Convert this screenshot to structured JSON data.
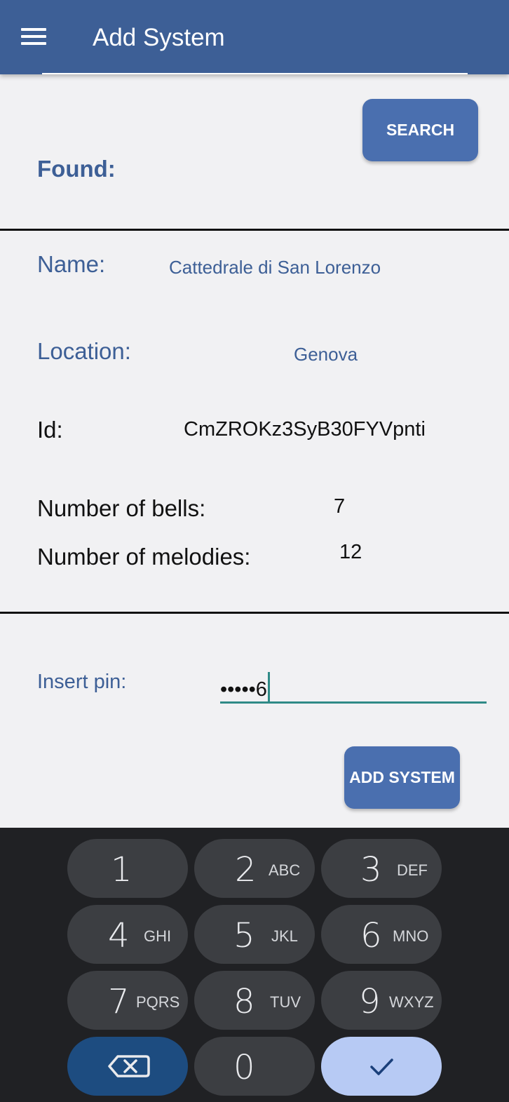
{
  "appbar": {
    "title": "Add System",
    "menu_icon": "hamburger-menu-icon"
  },
  "search": {
    "button_label": "SEARCH",
    "found_label": "Found:"
  },
  "details": {
    "name_label": "Name:",
    "name_value": "Cattedrale di San Lorenzo",
    "location_label": "Location:",
    "location_value": "Genova",
    "id_label": "Id:",
    "id_value": "CmZROKz3SyB30FYVpnti",
    "bells_label": "Number of bells:",
    "bells_value": "7",
    "melodies_label": "Number of melodies:",
    "melodies_value": "12"
  },
  "pin": {
    "label": "Insert pin:",
    "value": "•••••6"
  },
  "add_button_label": "ADD SYSTEM",
  "keyboard": {
    "keys": [
      {
        "num": "1",
        "letters": ""
      },
      {
        "num": "2",
        "letters": "ABC"
      },
      {
        "num": "3",
        "letters": "DEF"
      },
      {
        "num": "4",
        "letters": "GHI"
      },
      {
        "num": "5",
        "letters": "JKL"
      },
      {
        "num": "6",
        "letters": "MNO"
      },
      {
        "num": "7",
        "letters": "PQRS"
      },
      {
        "num": "8",
        "letters": "TUV"
      },
      {
        "num": "9",
        "letters": "WXYZ"
      },
      {
        "num": "0",
        "letters": ""
      }
    ],
    "delete_icon": "backspace-icon",
    "done_icon": "checkmark-icon"
  },
  "colors": {
    "primary": "#3d5f96",
    "button": "#4a6faf",
    "accent": "#2f8a87",
    "keyboard_bg": "#202124",
    "key_bg": "#3c3e42",
    "delete_key": "#1d4c80",
    "done_key": "#b7caf4"
  }
}
